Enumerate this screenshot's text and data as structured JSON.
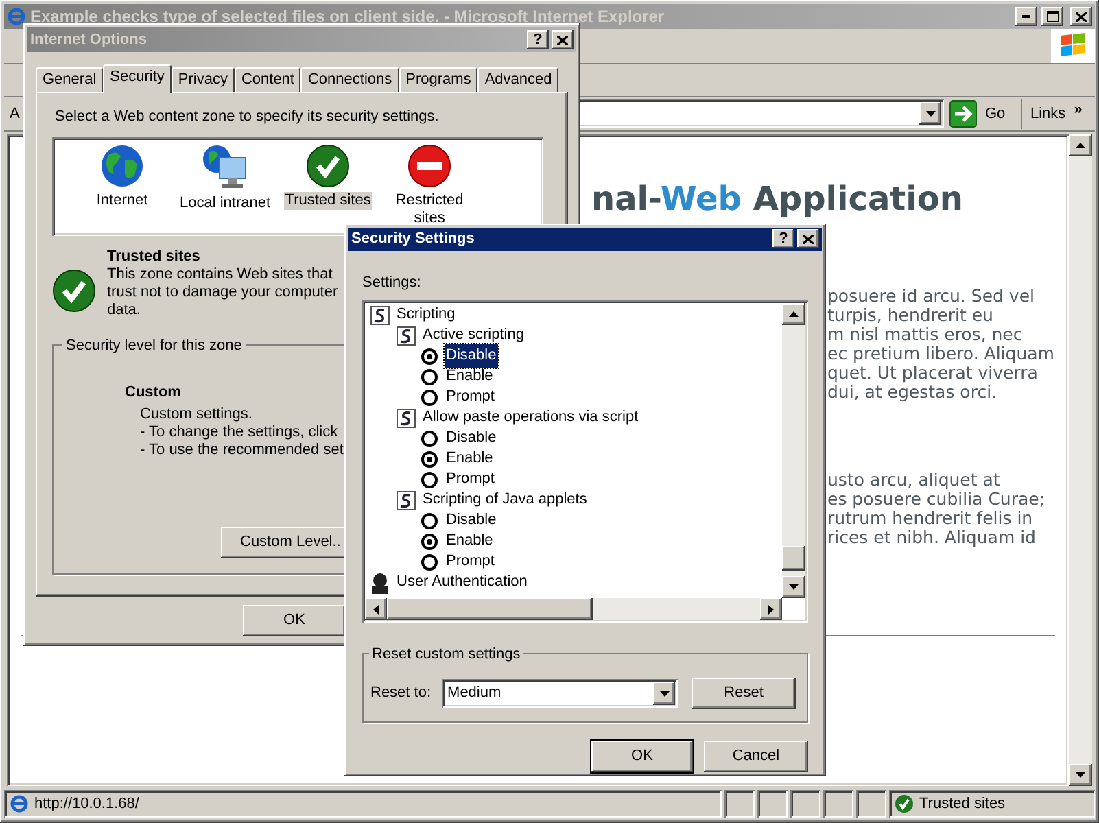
{
  "browser": {
    "title": "Example checks type of selected files on client side. - Microsoft Internet Explorer",
    "address_label": "A",
    "go_button": "Go",
    "links_button": "Links",
    "links_chevron": "»",
    "heading": {
      "prefix": "nal-",
      "highlight": "Web",
      "suffix": " Application"
    },
    "paragraphs": [
      [
        "posuere id arcu. Sed vel",
        "turpis, hendrerit eu",
        "m nisl mattis eros, nec",
        "ec pretium libero. Aliquam",
        "quet. Ut placerat viverra",
        "dui, at egestas orci."
      ],
      [
        "usto arcu, aliquet at",
        "es posuere cubilia Curae;",
        "rutrum hendrerit felis in",
        "rices et nibh. Aliquam id"
      ]
    ],
    "status_url": "http://10.0.1.68/",
    "status_zone": "Trusted sites"
  },
  "internet_options": {
    "title": "Internet Options",
    "help_button": "?",
    "tabs": [
      {
        "label": "General",
        "selected": false
      },
      {
        "label": "Security",
        "selected": true
      },
      {
        "label": "Privacy",
        "selected": false
      },
      {
        "label": "Content",
        "selected": false
      },
      {
        "label": "Connections",
        "selected": false
      },
      {
        "label": "Programs",
        "selected": false
      },
      {
        "label": "Advanced",
        "selected": false
      }
    ],
    "zone_prompt": "Select a Web content zone to specify its security settings.",
    "zones": [
      {
        "label": "Internet",
        "kind": "internet",
        "selected": false
      },
      {
        "label": "Local intranet",
        "kind": "intranet",
        "selected": false
      },
      {
        "label": "Trusted sites",
        "kind": "trusted",
        "selected": true
      },
      {
        "label": "Restricted sites",
        "kind": "restricted",
        "selected": false
      }
    ],
    "zone_title": "Trusted sites",
    "zone_description": [
      "This zone contains Web sites that",
      "trust not to damage your computer",
      "data."
    ],
    "level_legend": "Security level for this zone",
    "level_name": "Custom",
    "level_lines": [
      "Custom settings.",
      "- To change the settings, click",
      "- To use the recommended set"
    ],
    "custom_level_button": "Custom Level..",
    "ok_button": "OK"
  },
  "security_settings": {
    "title": "Security Settings",
    "help_button": "?",
    "settings_label": "Settings:",
    "tree": [
      {
        "label": "Scripting",
        "kind": "script",
        "children": [
          {
            "label": "Active scripting",
            "kind": "script",
            "children": [
              {
                "label": "Disable",
                "kind": "option",
                "selected": true,
                "focused": true
              },
              {
                "label": "Enable",
                "kind": "option",
                "selected": false,
                "focused": false
              },
              {
                "label": "Prompt",
                "kind": "option",
                "selected": false,
                "focused": false
              }
            ]
          },
          {
            "label": "Allow paste operations via script",
            "kind": "script",
            "children": [
              {
                "label": "Disable",
                "kind": "option",
                "selected": false,
                "focused": false
              },
              {
                "label": "Enable",
                "kind": "option",
                "selected": true,
                "focused": false
              },
              {
                "label": "Prompt",
                "kind": "option",
                "selected": false,
                "focused": false
              }
            ]
          },
          {
            "label": "Scripting of Java applets",
            "kind": "script",
            "children": [
              {
                "label": "Disable",
                "kind": "option",
                "selected": false,
                "focused": false
              },
              {
                "label": "Enable",
                "kind": "option",
                "selected": true,
                "focused": false
              },
              {
                "label": "Prompt",
                "kind": "option",
                "selected": false,
                "focused": false
              }
            ]
          }
        ]
      },
      {
        "label": "User Authentication",
        "kind": "user"
      }
    ],
    "reset_legend": "Reset custom settings",
    "reset_label": "Reset to:",
    "reset_value": "Medium",
    "reset_button": "Reset",
    "ok_button": "OK",
    "cancel_button": "Cancel"
  }
}
